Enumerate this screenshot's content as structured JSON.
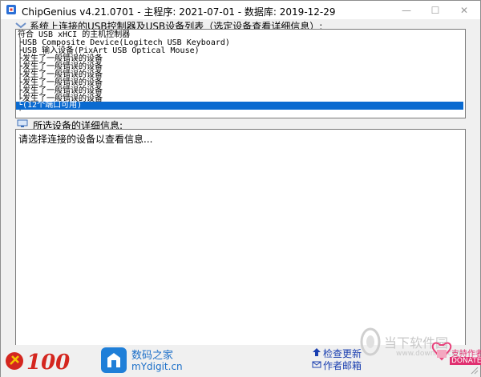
{
  "window": {
    "title": "ChipGenius v4.21.0701 - 主程序: 2021-07-01 - 数据库: 2019-12-29",
    "min_glyph": "—",
    "max_glyph": "☐",
    "close_glyph": "✕"
  },
  "device_list": {
    "label": "系统上连接的USB控制器及USB设备列表（选定设备查看详细信息）:",
    "items": [
      "符合 USB xHCI 的主机控制器",
      "├USB Composite Device(Logitech USB Keyboard)",
      "├USB 输入设备(PixArt USB Optical Mouse)",
      "├发生了一般错误的设备",
      "├发生了一般错误的设备",
      "├发生了一般错误的设备",
      "├发生了一般错误的设备",
      "├发生了一般错误的设备",
      "├发生了一般错误的设备",
      "├发生了一般错误的设备",
      "└(12个端口可用)"
    ],
    "selected_index": 10
  },
  "details": {
    "label": "所选设备的详细信息:",
    "text": "请选择连接的设备以查看信息..."
  },
  "footer": {
    "brand_name": "数码之家",
    "brand_url": "mYdigit.cn",
    "update_link": "检查更新",
    "email_link": "作者邮箱",
    "donate_label": "支持作者",
    "donate_sub": "DONATE"
  },
  "watermark": {
    "text": "当下软件园",
    "sub": "www.downxia.com"
  },
  "colors": {
    "selection": "#0a6ad0",
    "link": "#1a3fb0"
  }
}
